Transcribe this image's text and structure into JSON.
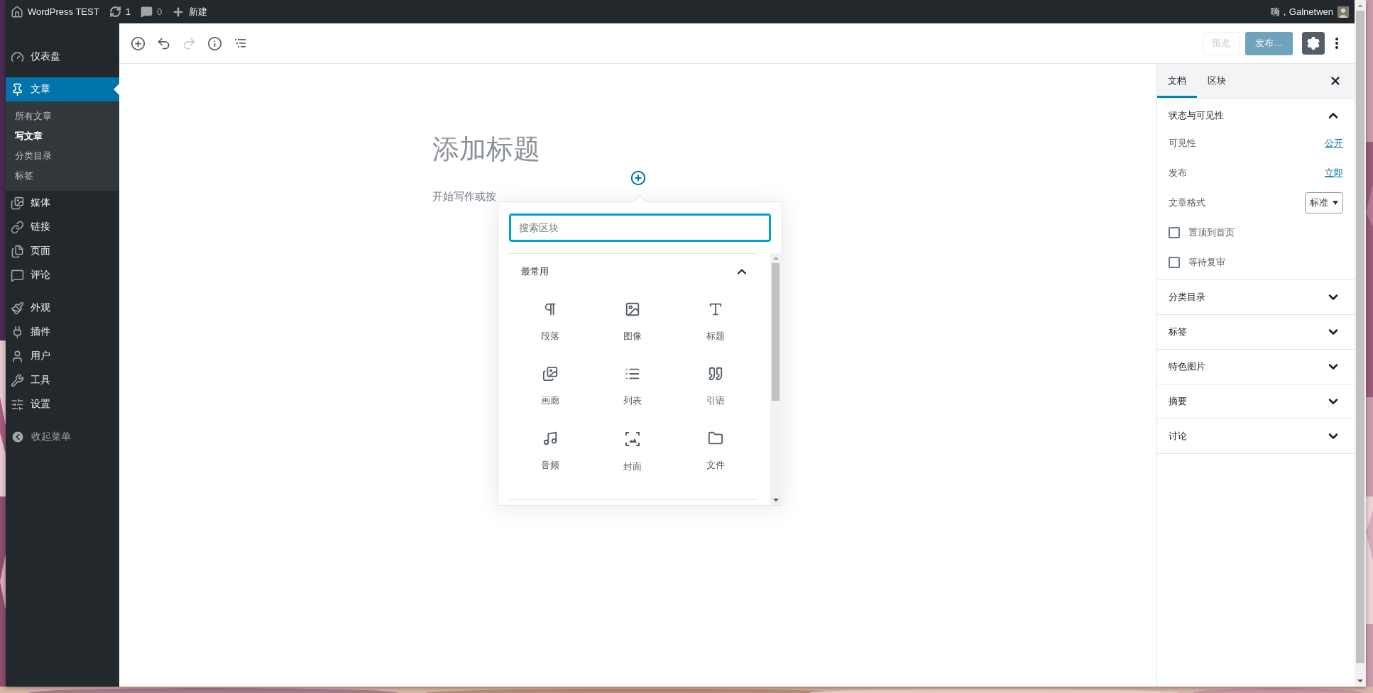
{
  "admin_bar": {
    "site": "WordPress TEST",
    "updates": "1",
    "comments": "0",
    "new": "新建",
    "greeting": "嗨，Galnetwen"
  },
  "menu": [
    {
      "items": [
        {
          "label": "仪表盘",
          "selected": false
        }
      ]
    },
    {
      "items": [
        {
          "label": "文章",
          "selected": true,
          "children": [
            {
              "label": "所有文章",
              "selected": false
            },
            {
              "label": "写文章",
              "selected": true
            },
            {
              "label": "分类目录",
              "selected": false
            },
            {
              "label": "标签",
              "selected": false
            }
          ]
        },
        {
          "label": "媒体",
          "selected": false
        },
        {
          "label": "链接",
          "selected": false
        },
        {
          "label": "页面",
          "selected": false
        },
        {
          "label": "评论",
          "selected": false
        }
      ]
    },
    {
      "items": [
        {
          "label": "外观",
          "selected": false
        },
        {
          "label": "插件",
          "selected": false
        },
        {
          "label": "用户",
          "selected": false
        },
        {
          "label": "工具",
          "selected": false
        },
        {
          "label": "设置",
          "selected": false
        }
      ]
    }
  ],
  "collapse_menu": "收起菜单",
  "header": {
    "tools": [
      {
        "disabled": false
      },
      {
        "disabled": false
      },
      {
        "disabled": true
      },
      {
        "disabled": false
      },
      {
        "disabled": false
      }
    ],
    "preview": {
      "label": "预览",
      "disabled": true
    },
    "publish": {
      "label": "发布…",
      "disabled": true
    },
    "settings": {
      "pressed": true
    }
  },
  "post": {
    "title": {
      "placeholder": "添加标题"
    },
    "paragraph": {
      "placeholder": "开始写作或按"
    }
  },
  "inserter": {
    "search": {
      "placeholder": "搜索区块"
    },
    "category": {
      "title": "最常用",
      "expanded": true
    },
    "blocks": [
      {
        "label": "段落"
      },
      {
        "label": "图像"
      },
      {
        "label": "标题"
      },
      {
        "label": "画廊"
      },
      {
        "label": "列表"
      },
      {
        "label": "引语"
      },
      {
        "label": "音频"
      },
      {
        "label": "封面"
      },
      {
        "label": "文件"
      }
    ]
  },
  "settings": {
    "tabs": [
      {
        "label": "文档",
        "selected": true
      },
      {
        "label": "区块",
        "selected": false
      }
    ],
    "panels": [
      {
        "title": "状态与可见性",
        "expanded": true,
        "rows": [
          {
            "kind": "link",
            "label": "可见性",
            "value": "公开"
          },
          {
            "kind": "link",
            "label": "发布",
            "value": "立即"
          },
          {
            "kind": "select",
            "label": "文章格式",
            "value": "标准"
          },
          {
            "kind": "checkbox",
            "label": "置顶到首页",
            "checked": false
          },
          {
            "kind": "checkbox",
            "label": "等待复审",
            "checked": false
          }
        ]
      },
      {
        "title": "分类目录",
        "expanded": false
      },
      {
        "title": "标签",
        "expanded": false
      },
      {
        "title": "特色图片",
        "expanded": false
      },
      {
        "title": "摘要",
        "expanded": false
      },
      {
        "title": "讨论",
        "expanded": false
      }
    ]
  }
}
